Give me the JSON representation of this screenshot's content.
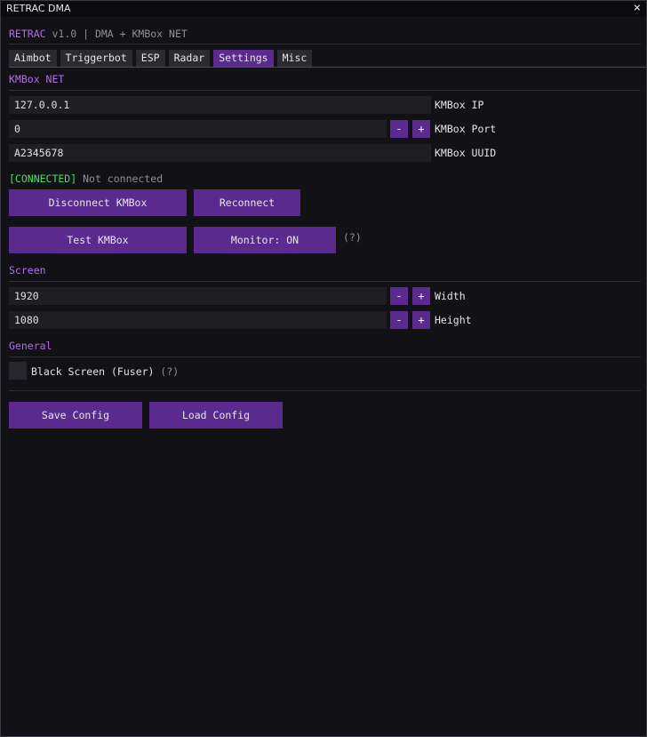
{
  "window": {
    "title": "RETRAC DMA",
    "close_icon": "×"
  },
  "header": {
    "brand": "RETRAC",
    "version": "v1.0 | DMA + KMBox NET"
  },
  "tabs": [
    {
      "label": "Aimbot"
    },
    {
      "label": "Triggerbot"
    },
    {
      "label": "ESP"
    },
    {
      "label": "Radar"
    },
    {
      "label": "Settings",
      "active": true
    },
    {
      "label": "Misc"
    }
  ],
  "kmbox": {
    "section": "KMBox NET",
    "ip_value": "127.0.0.1",
    "ip_label": "KMBox IP",
    "port_value": "0",
    "port_label": "KMBox Port",
    "uuid_value": "A2345678",
    "uuid_label": "KMBox UUID",
    "status_tag": "[CONNECTED]",
    "status_text": "Not connected",
    "disconnect_label": "Disconnect KMBox",
    "reconnect_label": "Reconnect",
    "test_label": "Test KMBox",
    "monitor_label": "Monitor: ON",
    "help_hint": "(?)"
  },
  "screen": {
    "section": "Screen",
    "width_value": "1920",
    "width_label": "Width",
    "height_value": "1080",
    "height_label": "Height"
  },
  "general": {
    "section": "General",
    "black_screen_label": "Black Screen (Fuser)",
    "black_screen_hint": "(?)",
    "black_screen_checked": false
  },
  "footer": {
    "save_label": "Save Config",
    "load_label": "Load Config"
  },
  "stepper": {
    "minus": "-",
    "plus": "+"
  },
  "colors": {
    "accent": "#5a2a8f",
    "accent_text": "#b06ee8",
    "connected": "#46e35a",
    "background": "#111116"
  }
}
